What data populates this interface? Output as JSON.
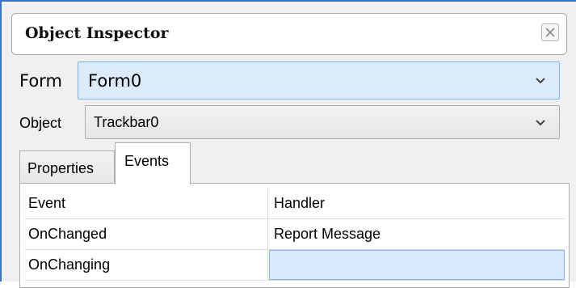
{
  "window": {
    "title": "Object Inspector"
  },
  "form_selector": {
    "label": "Form",
    "value": "Form0"
  },
  "object_selector": {
    "label": "Object",
    "value": "Trackbar0"
  },
  "tabs": [
    {
      "label": "Properties",
      "active": false
    },
    {
      "label": "Events",
      "active": true
    }
  ],
  "events_table": {
    "columns": [
      "Event",
      "Handler"
    ],
    "rows": [
      {
        "event": "OnChanged",
        "handler": "Report Message"
      },
      {
        "event": "OnChanging",
        "handler": ""
      }
    ]
  },
  "icons": {
    "close": "close-icon",
    "dropdown": "chevron-down-icon"
  },
  "colors": {
    "window_frame": "#3b72b9",
    "selection_fill": "#dcebfc",
    "selection_border": "#7eb4ea"
  }
}
